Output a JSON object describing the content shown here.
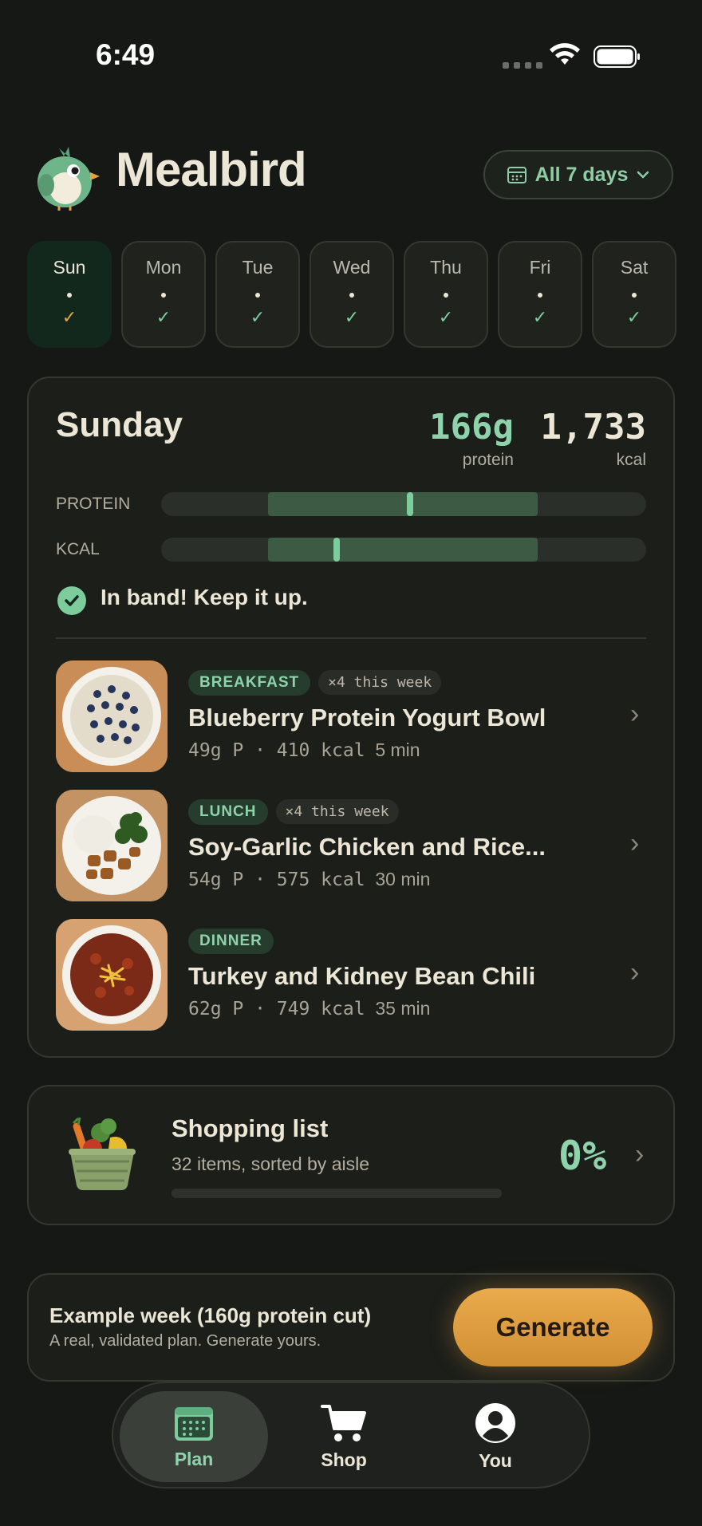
{
  "status": {
    "time": "6:49"
  },
  "header": {
    "app_name": "Mealbird",
    "days_filter": "All 7 days"
  },
  "days": [
    {
      "label": "Sun",
      "active": true
    },
    {
      "label": "Mon",
      "active": false
    },
    {
      "label": "Tue",
      "active": false
    },
    {
      "label": "Wed",
      "active": false
    },
    {
      "label": "Thu",
      "active": false
    },
    {
      "label": "Fri",
      "active": false
    },
    {
      "label": "Sat",
      "active": false
    }
  ],
  "summary": {
    "day": "Sunday",
    "protein_value": "166g",
    "protein_label": "protein",
    "kcal_value": "1,733",
    "kcal_label": "kcal",
    "bar_protein_label": "PROTEIN",
    "bar_kcal_label": "KCAL",
    "status_text": "In band! Keep it up."
  },
  "meals": [
    {
      "tag": "BREAKFAST",
      "count": "×4 this week",
      "name": "Blueberry Protein Yogurt Bowl",
      "macros": "49g P · 410 kcal",
      "time": "5 min"
    },
    {
      "tag": "LUNCH",
      "count": "×4 this week",
      "name": "Soy-Garlic Chicken and Rice...",
      "macros": "54g P · 575 kcal",
      "time": "30 min"
    },
    {
      "tag": "DINNER",
      "count": "",
      "name": "Turkey and Kidney Bean Chili",
      "macros": "62g P · 749 kcal",
      "time": "35 min"
    }
  ],
  "shopping": {
    "title": "Shopping list",
    "subtitle": "32 items, sorted by aisle",
    "percent": "0%",
    "progress": 0
  },
  "example": {
    "title": "Example week (160g protein cut)",
    "subtitle": "A real, validated plan. Generate yours.",
    "button": "Generate"
  },
  "nav": [
    {
      "label": "Plan",
      "icon": "calendar-icon",
      "active": true
    },
    {
      "label": "Shop",
      "icon": "cart-icon",
      "active": false
    },
    {
      "label": "You",
      "icon": "user-icon",
      "active": false
    }
  ],
  "colors": {
    "accent_green": "#8fd3ad",
    "accent_orange": "#e3a347",
    "background": "#161815"
  }
}
